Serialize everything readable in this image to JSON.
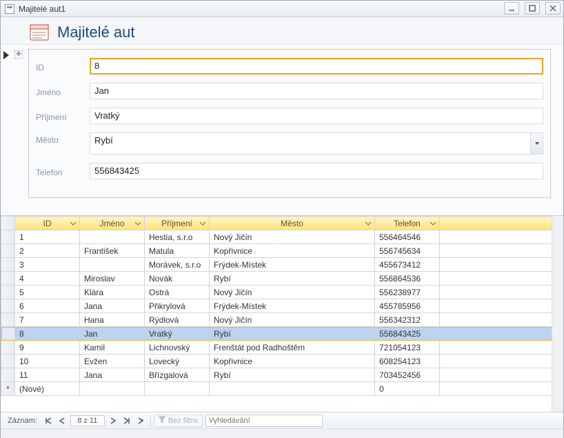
{
  "window": {
    "title": "Majitelé aut1"
  },
  "form": {
    "title": "Majitelé aut",
    "labels": {
      "id": "ID",
      "jmeno": "Jméno",
      "prijmeni": "Příjmení",
      "mesto": "Město",
      "telefon": "Telefon"
    },
    "values": {
      "id": "8",
      "jmeno": "Jan",
      "prijmeni": "Vratký",
      "mesto": "Rybí",
      "telefon": "556843425"
    }
  },
  "datasheet": {
    "headers": {
      "id": "ID",
      "jmeno": "Jméno",
      "prijmeni": "Příjmení",
      "mesto": "Město",
      "telefon": "Telefon"
    },
    "new_row_label": "(Nové)",
    "new_row_telefon": "0",
    "selected_id": "8",
    "rows": [
      {
        "id": "1",
        "jmeno": "",
        "prijmeni": "Hestia, s.r.o",
        "mesto": "Nový Jičín",
        "telefon": "556464546"
      },
      {
        "id": "2",
        "jmeno": "František",
        "prijmeni": "Matula",
        "mesto": "Kopřivnice",
        "telefon": "556745634"
      },
      {
        "id": "3",
        "jmeno": "",
        "prijmeni": "Morávek, s.r.o",
        "mesto": "Frýdek-Místek",
        "telefon": "455673412"
      },
      {
        "id": "4",
        "jmeno": "Miroslav",
        "prijmeni": "Novák",
        "mesto": "Rybí",
        "telefon": "556864536"
      },
      {
        "id": "5",
        "jmeno": "Klára",
        "prijmeni": "Ostrá",
        "mesto": "Nový Jičín",
        "telefon": "556238977"
      },
      {
        "id": "6",
        "jmeno": "Jana",
        "prijmeni": "Přikrylová",
        "mesto": "Frýdek-Místek",
        "telefon": "455785956"
      },
      {
        "id": "7",
        "jmeno": "Hana",
        "prijmeni": "Rýdlová",
        "mesto": "Nový Jičín",
        "telefon": "556342312"
      },
      {
        "id": "8",
        "jmeno": "Jan",
        "prijmeni": "Vratký",
        "mesto": "Rybí",
        "telefon": "556843425"
      },
      {
        "id": "9",
        "jmeno": "Kamil",
        "prijmeni": "Lichnovský",
        "mesto": "Frenštát pod Radhoštěm",
        "telefon": "721054123"
      },
      {
        "id": "10",
        "jmeno": "Evžen",
        "prijmeni": "Lovecký",
        "mesto": "Kopřivnice",
        "telefon": "608254123"
      },
      {
        "id": "11",
        "jmeno": "Jana",
        "prijmeni": "Břízgalová",
        "mesto": "Rybí",
        "telefon": "703452456"
      }
    ]
  },
  "nav": {
    "label": "Záznam:",
    "position": "8 z 11",
    "filter_label": "Bez filtru",
    "search_placeholder": "Vyhledávání"
  }
}
